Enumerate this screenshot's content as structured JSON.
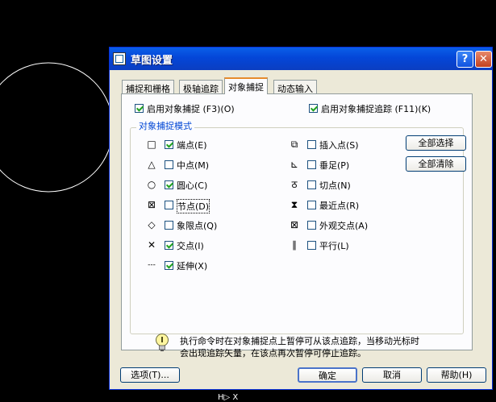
{
  "dialog": {
    "title": "草图设置",
    "help_glyph": "?",
    "close_glyph": "✕"
  },
  "tabs": [
    {
      "label": "捕捉和栅格"
    },
    {
      "label": "极轴追踪"
    },
    {
      "label": "对象捕捉"
    },
    {
      "label": "动态输入"
    }
  ],
  "toggles": {
    "enable_snap": {
      "label": "启用对象捕捉 (F3)(O)",
      "checked": true
    },
    "enable_tracking": {
      "label": "启用对象捕捉追踪 (F11)(K)",
      "checked": true
    }
  },
  "group_title": "对象捕捉模式",
  "modes_left": [
    {
      "symbol": "□",
      "label": "端点(E)",
      "checked": true
    },
    {
      "symbol": "△",
      "label": "中点(M)",
      "checked": false
    },
    {
      "symbol": "○",
      "label": "圆心(C)",
      "checked": true
    },
    {
      "symbol": "⊠",
      "label": "节点(D)",
      "checked": false
    },
    {
      "symbol": "◇",
      "label": "象限点(Q)",
      "checked": false
    },
    {
      "symbol": "✕",
      "label": "交点(I)",
      "checked": true
    },
    {
      "symbol": "---",
      "label": "延伸(X)",
      "checked": true
    }
  ],
  "modes_right": [
    {
      "symbol": "⧉",
      "label": "插入点(S)",
      "checked": false
    },
    {
      "symbol": "⊾",
      "label": "垂足(P)",
      "checked": false
    },
    {
      "symbol": "ठ",
      "label": "切点(N)",
      "checked": false
    },
    {
      "symbol": "⧗",
      "label": "最近点(R)",
      "checked": false
    },
    {
      "symbol": "⊠",
      "label": "外观交点(A)",
      "checked": false
    },
    {
      "symbol": "∥",
      "label": "平行(L)",
      "checked": false
    }
  ],
  "side_buttons": {
    "select_all": "全部选择",
    "clear_all": "全部清除"
  },
  "info": {
    "line1": "执行命令时在对象捕捉点上暂停可从该点追踪，当移动光标时",
    "line2": "会出现追踪矢量，在该点再次暂停可停止追踪。"
  },
  "bottom_buttons": {
    "options": "选项(T)...",
    "ok": "确定",
    "cancel": "取消",
    "help": "帮助(H)"
  },
  "canvas": {
    "status_line": "H▷ X"
  },
  "colors": {
    "title_bar": "#0446d8",
    "dialog_bg": "#ece9d8",
    "group_title": "#0046d5",
    "canvas_bg": "#000000"
  }
}
